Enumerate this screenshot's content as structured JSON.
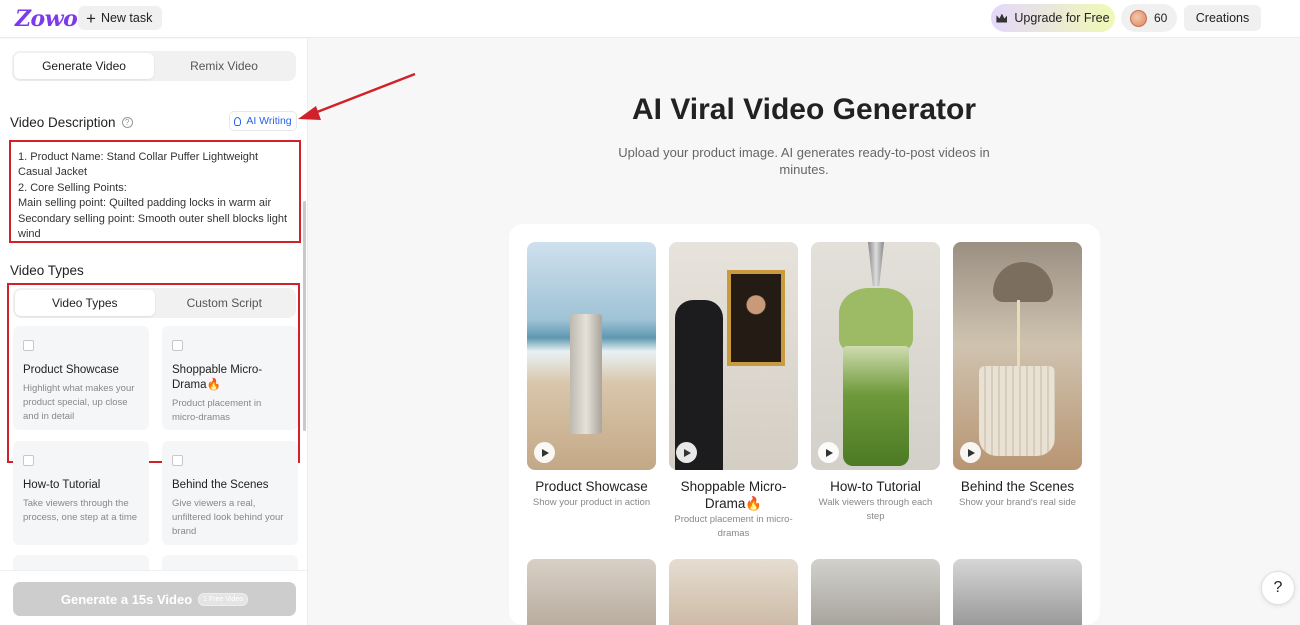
{
  "topbar": {
    "logo": "Zowo",
    "new_task": "New task",
    "upgrade": "Upgrade for Free",
    "credits": "60",
    "creations": "Creations"
  },
  "left": {
    "mode_tabs": [
      "Generate Video",
      "Remix Video"
    ],
    "video_description_label": "Video Description",
    "ai_writing": "AI Writing",
    "description_text": "1. Product Name: Stand Collar Puffer Lightweight Casual Jacket\n2. Core Selling Points:\nMain selling point: Quilted padding locks in warm air\nSecondary selling point: Smooth outer shell blocks light wind",
    "video_types_label": "Video Types",
    "type_tabs": [
      "Video Types",
      "Custom Script"
    ],
    "cards": [
      {
        "title": "Product Showcase",
        "desc": "Highlight what makes your product special, up close and in detail"
      },
      {
        "title": "Shoppable Micro-Drama🔥",
        "desc": "Product placement in micro-dramas"
      },
      {
        "title": "How-to Tutorial",
        "desc": "Take viewers through the process, one step at a time"
      },
      {
        "title": "Behind the Scenes",
        "desc": "Give viewers a real, unfiltered look behind your brand"
      }
    ],
    "generate_button": "Generate a 15s Video",
    "generate_badge": "1 Free Video"
  },
  "main": {
    "title": "AI Viral Video Generator",
    "subtitle": "Upload your product image. AI generates ready-to-post videos in minutes.",
    "tiles": [
      {
        "title": "Product Showcase",
        "desc": "Show your product in action"
      },
      {
        "title": "Shoppable Micro-Drama🔥",
        "desc": "Product placement in micro-dramas"
      },
      {
        "title": "How-to Tutorial",
        "desc": "Walk viewers through each step"
      },
      {
        "title": "Behind the Scenes",
        "desc": "Show your brand's real side"
      }
    ]
  },
  "help": "?",
  "colors": {
    "brand": "#7c3aed",
    "link": "#2563eb",
    "annotation": "#d0222a"
  }
}
